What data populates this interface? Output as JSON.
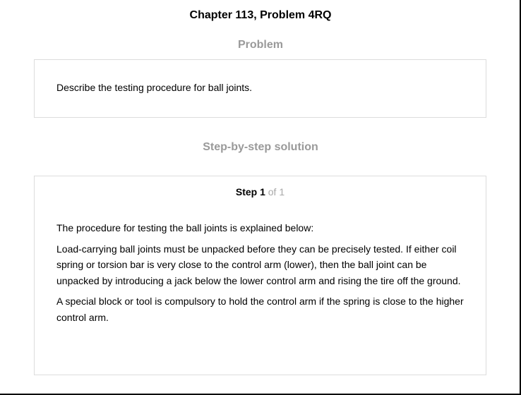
{
  "header": {
    "title": "Chapter 113, Problem 4RQ"
  },
  "problem": {
    "heading": "Problem",
    "text": "Describe the testing procedure for ball joints."
  },
  "solution": {
    "heading": "Step-by-step solution",
    "step": {
      "label": "Step 1",
      "of": " of 1"
    },
    "paragraphs": [
      "The procedure for testing the ball joints is explained below:",
      "Load-carrying ball joints must be unpacked before they can be precisely tested. If either coil spring or torsion bar is very close to the control arm (lower), then the ball joint can be unpacked by introducing a jack below the lower control arm and rising the tire off the ground.",
      "A special block or tool is compulsory to hold the control arm if the spring is close to the higher control arm."
    ]
  }
}
